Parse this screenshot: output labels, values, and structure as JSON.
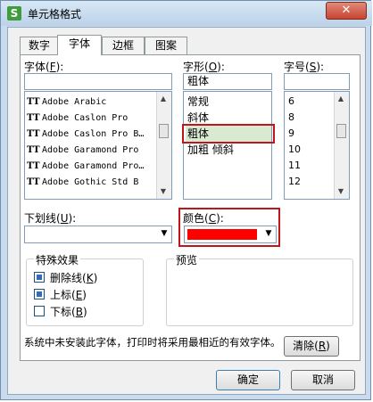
{
  "window": {
    "title": "单元格格式",
    "close": "✕",
    "icon": "S"
  },
  "tabs": [
    "数字",
    "字体",
    "边框",
    "图案"
  ],
  "font": {
    "label": "字体",
    "shortcut": "F",
    "input_value": "",
    "items": [
      "Adobe Arabic",
      "Adobe Caslon Pro",
      "Adobe Caslon Pro B…",
      "Adobe Garamond Pro",
      "Adobe Garamond Pro…",
      "Adobe Gothic Std B"
    ]
  },
  "style": {
    "label": "字形",
    "shortcut": "O",
    "input_value": "粗体",
    "items": [
      "常规",
      "斜体",
      "粗体",
      "加粗 倾斜"
    ],
    "selected_index": 2
  },
  "size": {
    "label": "字号",
    "shortcut": "S",
    "input_value": "",
    "items": [
      "6",
      "8",
      "9",
      "10",
      "11",
      "12"
    ]
  },
  "underline": {
    "label": "下划线",
    "shortcut": "U",
    "value": ""
  },
  "color": {
    "label": "颜色",
    "shortcut": "C",
    "value": "#ff0000"
  },
  "effects": {
    "title": "特殊效果",
    "items": [
      {
        "label": "删除线",
        "shortcut": "K",
        "checked": true
      },
      {
        "label": "上标",
        "shortcut": "E",
        "checked": true
      },
      {
        "label": "下标",
        "shortcut": "B",
        "checked": false
      }
    ]
  },
  "preview": {
    "title": "预览"
  },
  "note": "系统中未安装此字体，打印时将采用最相近的有效字体。",
  "buttons": {
    "clear": "清除",
    "clear_shortcut": "R",
    "ok": "确定",
    "cancel": "取消"
  },
  "colors": {
    "highlight_border": "#c0151b",
    "selected_row": "#d9ead3"
  }
}
